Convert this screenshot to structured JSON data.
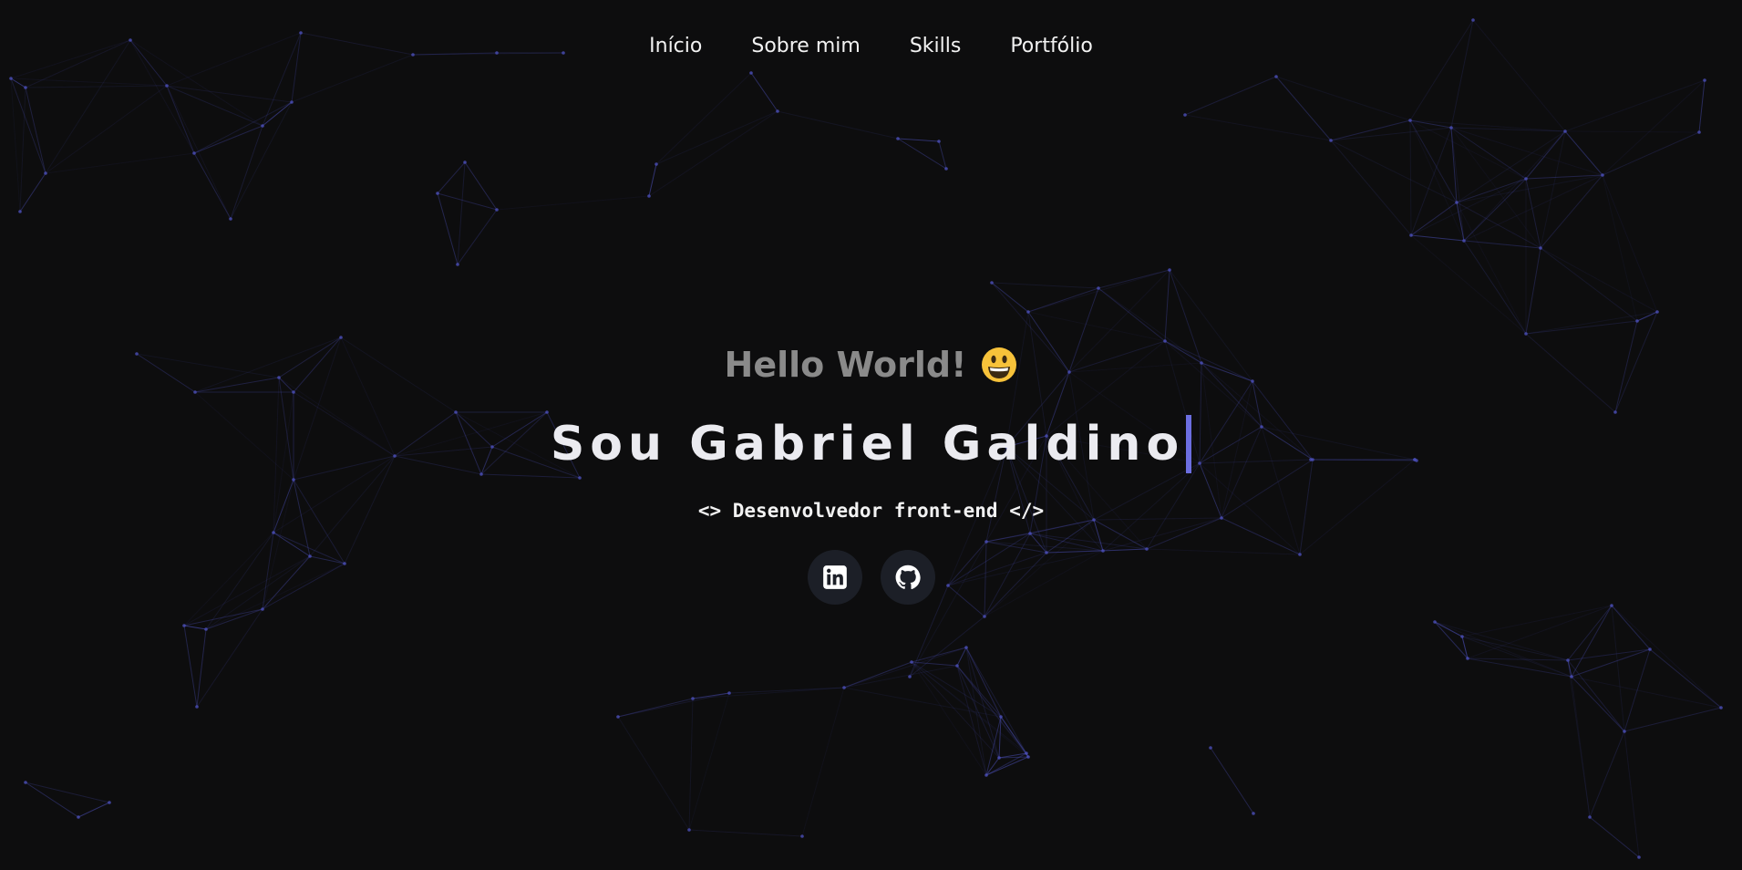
{
  "nav": {
    "items": [
      {
        "label": "Início"
      },
      {
        "label": "Sobre mim"
      },
      {
        "label": "Skills"
      },
      {
        "label": "Portfólio"
      }
    ]
  },
  "hero": {
    "greeting": "Hello World!",
    "greeting_emoji": "grinning-face",
    "name": "Sou Gabriel Galdino",
    "role": "<> Desenvolvedor front-end </>"
  },
  "social": [
    {
      "icon": "linkedin-icon"
    },
    {
      "icon": "github-icon"
    }
  ],
  "colors": {
    "background": "#0d0d0e",
    "accent": "#6c6ee0",
    "network_line": "#4b4fb8",
    "greeting": "#8a8a8a",
    "title": "#ebebf0",
    "button_bg": "#1c1f27"
  }
}
